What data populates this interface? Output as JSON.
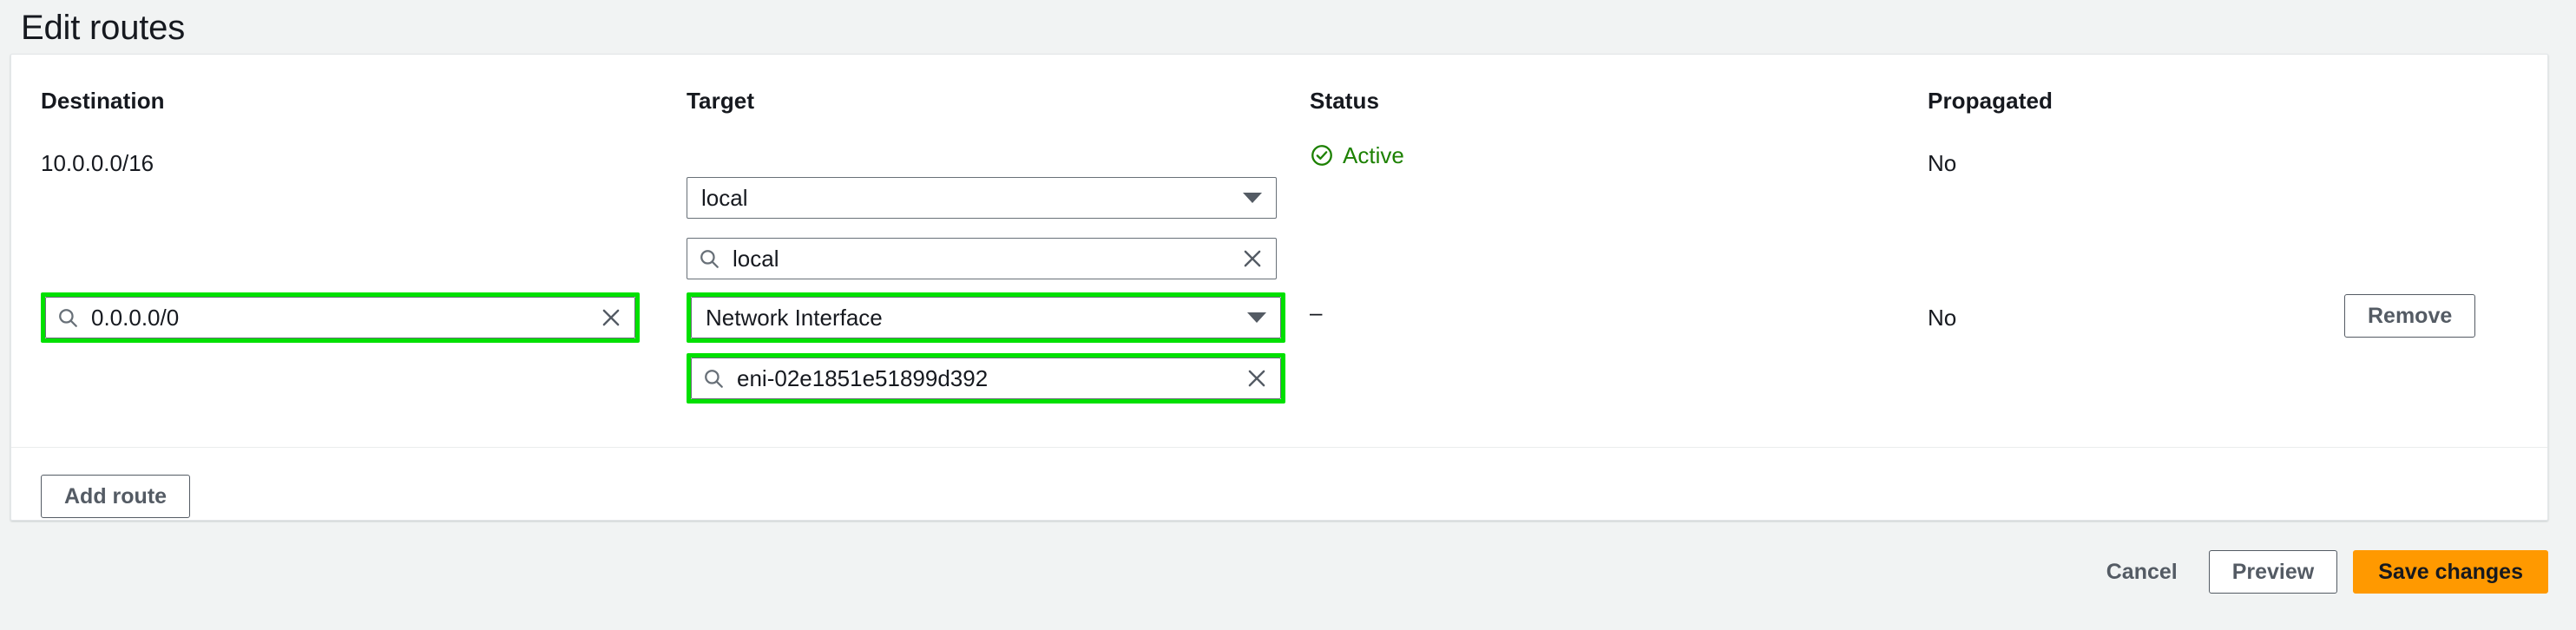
{
  "page": {
    "title": "Edit routes",
    "background_color": "#f1f3f3"
  },
  "colors": {
    "highlight_green": "#00e000",
    "status_active_green": "#1d8102",
    "primary_button_orange": "#ff9900",
    "control_border": "#687078",
    "card_background": "#ffffff"
  },
  "table": {
    "headers": {
      "destination": "Destination",
      "target": "Target",
      "status": "Status",
      "propagated": "Propagated"
    },
    "rows": [
      {
        "destination": {
          "type": "static",
          "value": "10.0.0.0/16",
          "highlighted": false
        },
        "target": {
          "select_value": "local",
          "search_value": "local",
          "search_placeholder": "Search",
          "select_highlighted": false,
          "search_highlighted": false
        },
        "status": {
          "label": "Active",
          "icon": "status-positive-icon"
        },
        "propagated": "No",
        "action": null
      },
      {
        "destination": {
          "type": "search",
          "value": "0.0.0.0/0",
          "placeholder": "Search",
          "highlighted": true
        },
        "target": {
          "select_value": "Network Interface",
          "search_value": "eni-02e1851e51899d392",
          "search_placeholder": "Search",
          "select_highlighted": true,
          "search_highlighted": true
        },
        "status": {
          "label": "–",
          "icon": null
        },
        "propagated": "No",
        "action": {
          "remove_label": "Remove"
        }
      }
    ]
  },
  "actions": {
    "add_route_label": "Add route"
  },
  "footer": {
    "cancel_label": "Cancel",
    "preview_label": "Preview",
    "save_label": "Save changes"
  },
  "icons": {
    "search": "search-icon",
    "clear": "close-icon",
    "dropdown": "chevron-down-icon",
    "status_positive": "check-circle-icon"
  }
}
